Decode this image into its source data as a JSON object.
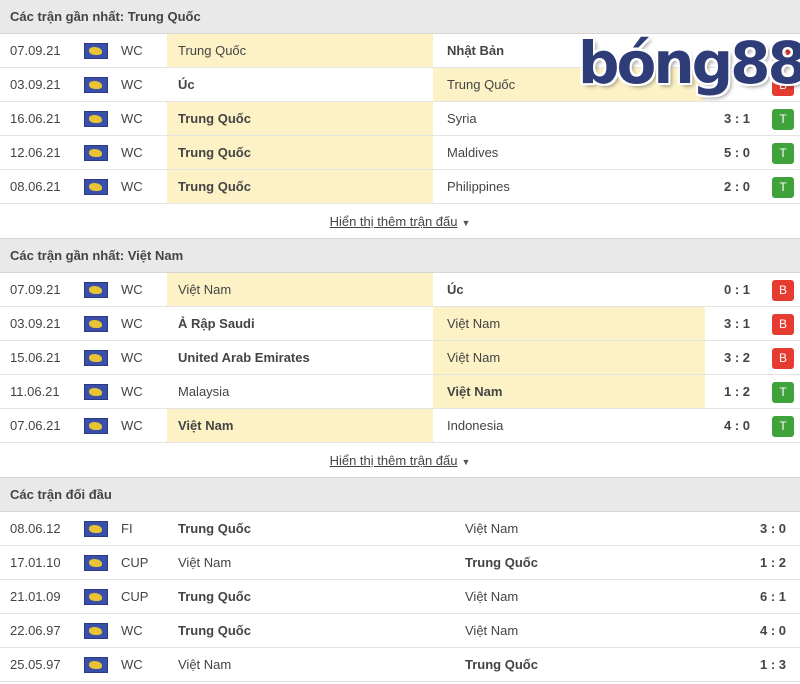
{
  "sections": [
    {
      "title": "Các trận gần nhất: Trung Quốc",
      "more": "Hiển thị thêm trận đấu",
      "rows": [
        {
          "date": "07.09.21",
          "comp": "WC",
          "home": "Trung Quốc",
          "away": "Nhật Bản",
          "score": "",
          "result": "B",
          "hl": "home",
          "bold": "away"
        },
        {
          "date": "03.09.21",
          "comp": "WC",
          "home": "Úc",
          "away": "Trung Quốc",
          "score": "",
          "result": "B",
          "hl": "away",
          "bold": "home"
        },
        {
          "date": "16.06.21",
          "comp": "WC",
          "home": "Trung Quốc",
          "away": "Syria",
          "score": "3 : 1",
          "result": "T",
          "hl": "home",
          "bold": "home"
        },
        {
          "date": "12.06.21",
          "comp": "WC",
          "home": "Trung Quốc",
          "away": "Maldives",
          "score": "5 : 0",
          "result": "T",
          "hl": "home",
          "bold": "home"
        },
        {
          "date": "08.06.21",
          "comp": "WC",
          "home": "Trung Quốc",
          "away": "Philippines",
          "score": "2 : 0",
          "result": "T",
          "hl": "home",
          "bold": "home"
        }
      ]
    },
    {
      "title": "Các trận gần nhất: Việt Nam",
      "more": "Hiển thị thêm trận đấu",
      "rows": [
        {
          "date": "07.09.21",
          "comp": "WC",
          "home": "Việt Nam",
          "away": "Úc",
          "score": "0 : 1",
          "result": "B",
          "hl": "home",
          "bold": "away"
        },
        {
          "date": "03.09.21",
          "comp": "WC",
          "home": "Ả Rập Saudi",
          "away": "Việt Nam",
          "score": "3 : 1",
          "result": "B",
          "hl": "away",
          "bold": "home"
        },
        {
          "date": "15.06.21",
          "comp": "WC",
          "home": "United Arab Emirates",
          "away": "Việt Nam",
          "score": "3 : 2",
          "result": "B",
          "hl": "away",
          "bold": "home"
        },
        {
          "date": "11.06.21",
          "comp": "WC",
          "home": "Malaysia",
          "away": "Việt Nam",
          "score": "1 : 2",
          "result": "T",
          "hl": "away",
          "bold": "away"
        },
        {
          "date": "07.06.21",
          "comp": "WC",
          "home": "Việt Nam",
          "away": "Indonesia",
          "score": "4 : 0",
          "result": "T",
          "hl": "home",
          "bold": "home"
        }
      ]
    },
    {
      "title": "Các trận đối đầu",
      "h2h": true,
      "rows": [
        {
          "date": "08.06.12",
          "comp": "FI",
          "home": "Trung Quốc",
          "away": "Việt Nam",
          "score": "3 : 0",
          "bold": "home"
        },
        {
          "date": "17.01.10",
          "comp": "CUP",
          "home": "Việt Nam",
          "away": "Trung Quốc",
          "score": "1 : 2",
          "bold": "away"
        },
        {
          "date": "21.01.09",
          "comp": "CUP",
          "home": "Trung Quốc",
          "away": "Việt Nam",
          "score": "6 : 1",
          "bold": "home"
        },
        {
          "date": "22.06.97",
          "comp": "WC",
          "home": "Trung Quốc",
          "away": "Việt Nam",
          "score": "4 : 0",
          "bold": "home"
        },
        {
          "date": "25.05.97",
          "comp": "WC",
          "home": "Việt Nam",
          "away": "Trung Quốc",
          "score": "1 : 3",
          "bold": "away"
        }
      ]
    }
  ],
  "logo": "bóng88",
  "colors": {
    "highlight": "#fcf2c6",
    "loss": "#e53b30",
    "win": "#3fa23a",
    "header": "#e9e9e9"
  }
}
